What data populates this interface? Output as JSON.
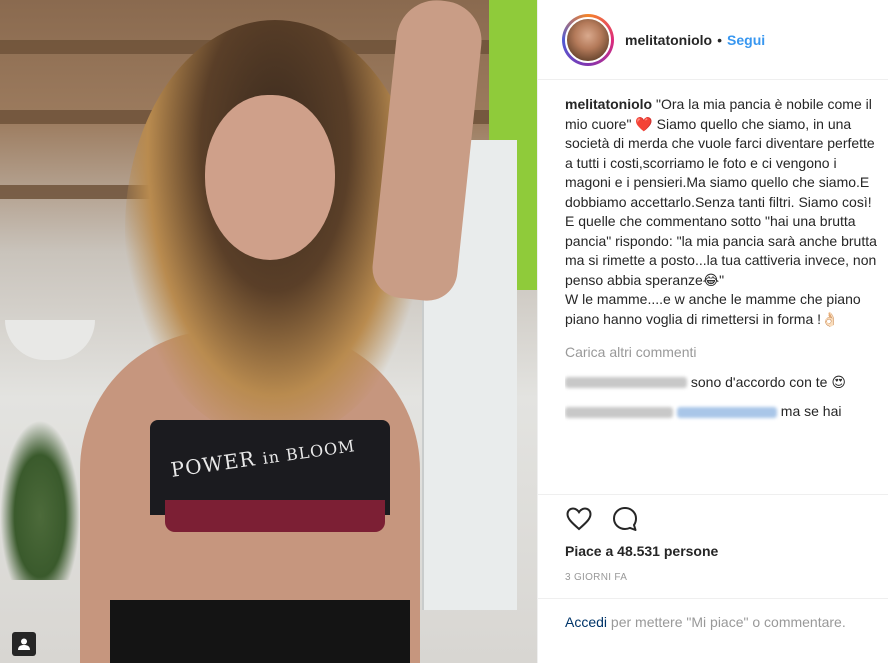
{
  "post": {
    "username": "melitatoniolo",
    "follow_label": "Segui",
    "dot": "•",
    "photo_print_line1": "POWER",
    "photo_print_line2": "in BLOOM"
  },
  "caption": {
    "username": "melitatoniolo",
    "text": "\"Ora la mia pancia è nobile come il mio cuore\" ❤️ Siamo quello che siamo, in una società di merda che vuole farci diventare perfette a tutti i costi,scorriamo le foto e ci vengono i magoni e i pensieri.Ma siamo quello che siamo.E dobbiamo accettarlo.Senza tanti filtri. Siamo così! E quelle che commentano sotto \"hai una brutta pancia\" rispondo: \"la mia pancia sarà anche brutta ma si rimette a posto...la tua cattiveria invece, non penso abbia speranze😂\"\nW le mamme....e w anche le mamme che piano piano hanno voglia di rimettersi in forma !👌🏻"
  },
  "comments": {
    "load_more": "Carica altri commenti",
    "items": [
      {
        "text": "sono d'accordo con te 😍"
      },
      {
        "text": "ma se hai"
      }
    ]
  },
  "footer": {
    "likes": "Piace a 48.531 persone",
    "time": "3 GIORNI FA",
    "login_link": "Accedi",
    "login_rest": " per mettere \"Mi piace\" o commentare."
  },
  "icons": {
    "like": "heart-icon",
    "comment": "comment-icon",
    "tag": "user-tag-icon"
  },
  "colors": {
    "link": "#3897f0",
    "muted": "#999999",
    "text": "#262626"
  }
}
